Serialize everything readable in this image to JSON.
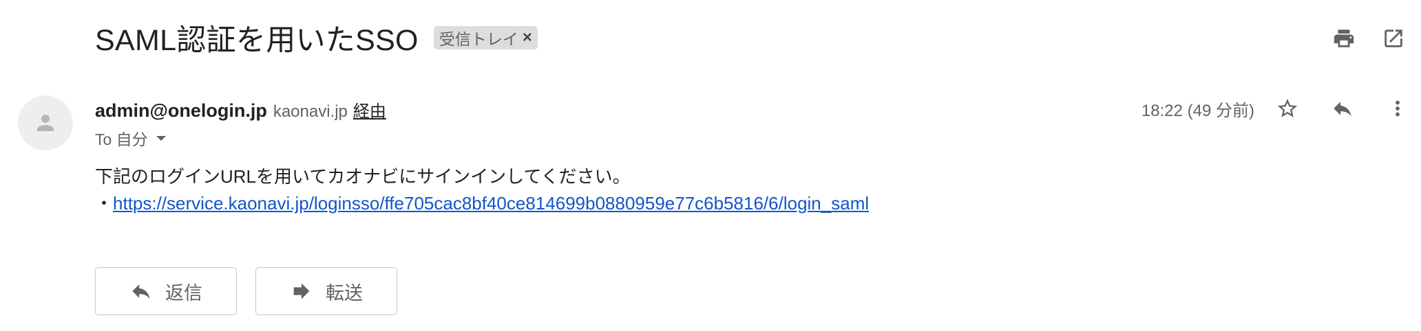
{
  "subject": "SAML認証を用いたSSO",
  "label_chip": {
    "text": "受信トレイ",
    "close": "×"
  },
  "top_actions": [
    "print-icon",
    "open-in-new-window-icon"
  ],
  "sender": {
    "email": "admin@onelogin.jp",
    "via_domain": "kaonavi.jp",
    "via_label": "経由",
    "to": "To 自分"
  },
  "meta": {
    "timestamp": "18:22 (49 分前)",
    "icons": [
      "star-icon",
      "reply-icon",
      "more-vert-icon"
    ]
  },
  "body": {
    "line1": "下記のログインURLを用いてカオナビにサインインしてください。",
    "bullet": "・",
    "link": "https://service.kaonavi.jp/loginsso/ffe705cac8bf40ce814699b0880959e77c6b5816/6/login_saml"
  },
  "buttons": {
    "reply": "返信",
    "forward": "転送"
  },
  "colors": {
    "link": "#1155cc",
    "icon": "#5f6368",
    "chip_bg": "#dddddd"
  }
}
